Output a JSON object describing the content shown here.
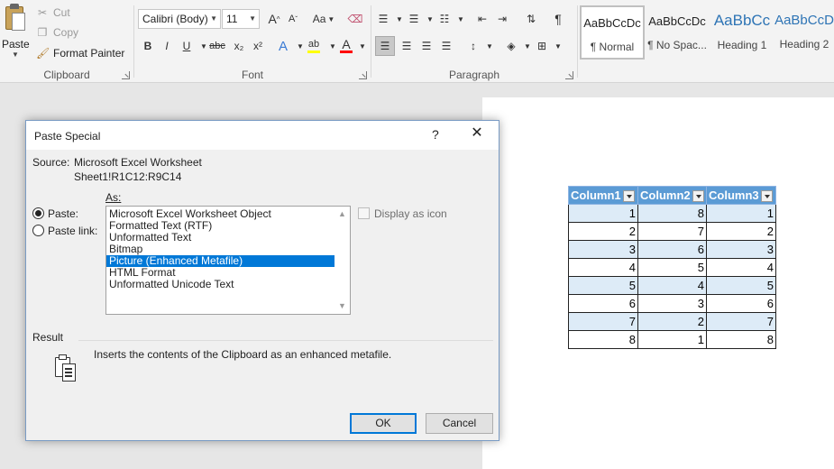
{
  "ribbon": {
    "clipboard": {
      "paste_label": "Paste",
      "cut_label": "Cut",
      "copy_label": "Copy",
      "format_painter_label": "Format Painter",
      "group_label": "Clipboard"
    },
    "font": {
      "font_name": "Calibri (Body)",
      "font_size": "11",
      "grow_label": "A",
      "shrink_label": "A",
      "case_label": "Aa",
      "bold_label": "B",
      "italic_label": "I",
      "underline_label": "U",
      "strike_label": "abc",
      "subscript_label": "x₂",
      "superscript_label": "x²",
      "effects_label": "A",
      "highlight_label": "ab",
      "color_label": "A",
      "group_label": "Font",
      "highlight_color": "#ffff00",
      "font_color": "#ff0000"
    },
    "paragraph": {
      "group_label": "Paragraph"
    },
    "styles": [
      {
        "sample": "AaBbCcDc",
        "name": "¶ Normal"
      },
      {
        "sample": "AaBbCcDc",
        "name": "¶ No Spac..."
      },
      {
        "sample": "AaBbCc",
        "name": "Heading 1"
      },
      {
        "sample": "AaBbCcD",
        "name": "Heading 2"
      }
    ]
  },
  "dialog": {
    "title": "Paste Special",
    "help": "?",
    "close": "✕",
    "source_label": "Source:",
    "source_value": "Microsoft Excel Worksheet",
    "source_range": "Sheet1!R1C12:R9C14",
    "as_label": "As:",
    "paste_label": "Paste:",
    "paste_link_label": "Paste link:",
    "display_as_icon_label": "Display as icon",
    "list_items": [
      "Microsoft Excel Worksheet Object",
      "Formatted Text (RTF)",
      "Unformatted Text",
      "Bitmap",
      "Picture (Enhanced Metafile)",
      "HTML Format",
      "Unformatted Unicode Text"
    ],
    "selected_item": "Picture (Enhanced Metafile)",
    "result_label": "Result",
    "result_text": "Inserts the contents of the Clipboard as an enhanced metafile.",
    "ok_label": "OK",
    "cancel_label": "Cancel"
  },
  "table": {
    "headers": [
      "Column1",
      "Column2",
      "Column3"
    ],
    "rows": [
      [
        "1",
        "8",
        "1"
      ],
      [
        "2",
        "7",
        "2"
      ],
      [
        "3",
        "6",
        "3"
      ],
      [
        "4",
        "5",
        "4"
      ],
      [
        "5",
        "4",
        "5"
      ],
      [
        "6",
        "3",
        "6"
      ],
      [
        "7",
        "2",
        "7"
      ],
      [
        "8",
        "1",
        "8"
      ]
    ],
    "header_color": "#5b9bd5",
    "band_color": "#ddebf7"
  }
}
